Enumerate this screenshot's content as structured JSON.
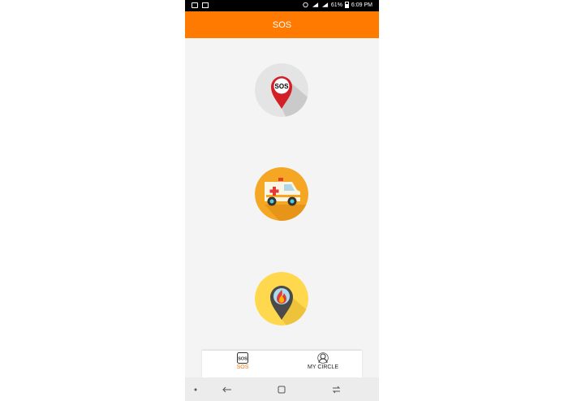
{
  "status_bar": {
    "battery": "61%",
    "time": "6:09 PM"
  },
  "app_bar": {
    "title": "SOS"
  },
  "actions": [
    {
      "label": "SOS",
      "icon": "sos-pin-icon"
    },
    {
      "icon": "ambulance-icon"
    },
    {
      "icon": "fire-location-icon"
    }
  ],
  "bottom_nav": {
    "items": [
      {
        "label": "SOS",
        "icon": "sos-tab-icon",
        "active": true
      },
      {
        "label": "MY CIRCLE",
        "icon": "circle-tab-icon",
        "active": false
      }
    ]
  },
  "colors": {
    "accent": "#ff7a00",
    "active_tab": "#f07c1a",
    "sos_red": "#d32027",
    "ambulance_bg": "#f5a623",
    "fire_bg": "#ffd84d"
  }
}
